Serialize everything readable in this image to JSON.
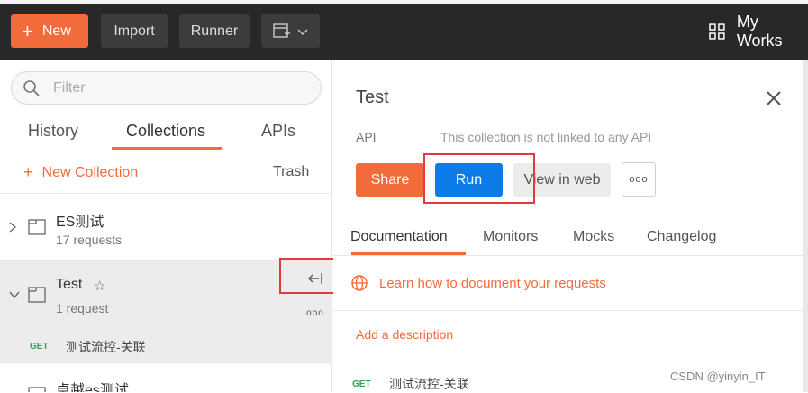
{
  "topbar": {
    "new_label": "New",
    "import_label": "Import",
    "runner_label": "Runner",
    "workspace_label": "My Works"
  },
  "sidebar": {
    "filter_placeholder": "Filter",
    "tabs": [
      "History",
      "Collections",
      "APIs"
    ],
    "active_tab": "Collections",
    "new_collection": "New Collection",
    "trash": "Trash",
    "collections": [
      {
        "name": "ES测试",
        "count": "17 requests"
      },
      {
        "name": "Test",
        "count": "1 request",
        "star": "☆",
        "requests": [
          {
            "method": "GET",
            "name": "测试流控-关联"
          }
        ]
      },
      {
        "name": "卓越es测试"
      }
    ]
  },
  "main": {
    "title": "Test",
    "api_label": "API",
    "api_note": "This collection is not linked to any API",
    "share_label": "Share",
    "run_label": "Run",
    "view_web_label": "View in web",
    "more_label": "ooo",
    "tabs": [
      "Documentation",
      "Monitors",
      "Mocks",
      "Changelog"
    ],
    "active_tab": "Documentation",
    "learn_link": "Learn how to document your requests",
    "add_description": "Add a description",
    "request": {
      "method": "GET",
      "name": "测试流控-关联"
    }
  },
  "watermark": "CSDN @yinyin_IT",
  "colors": {
    "accent": "#f26b3a",
    "run_blue": "#0b7be8",
    "topbar": "#282828",
    "highlight": "#e33b3b"
  }
}
